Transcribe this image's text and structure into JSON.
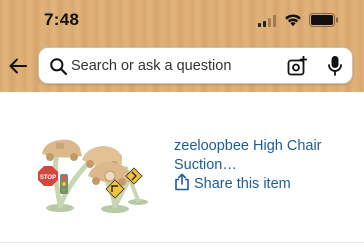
{
  "status_bar": {
    "time": "7:48"
  },
  "header": {
    "back_icon": "back-arrow-icon",
    "search": {
      "placeholder": "Search or ask a question",
      "left_icon": "search-icon",
      "camera_icon": "camera-icon",
      "mic_icon": "mic-icon"
    },
    "background_color": "#ddac73"
  },
  "product": {
    "image_alt": "product-image",
    "title": "zeeloopbee High Chair Suction…",
    "share_label": "Share this item",
    "share_icon": "share-icon"
  },
  "colors": {
    "link": "#1c5d99"
  }
}
